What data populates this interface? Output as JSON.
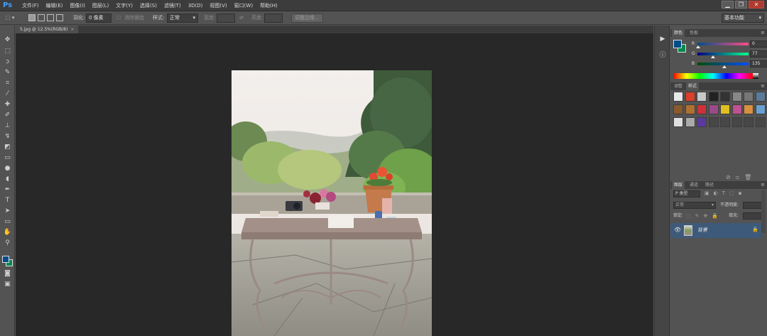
{
  "app": {
    "logo": "Ps"
  },
  "menu": [
    "文件(F)",
    "编辑(E)",
    "图像(I)",
    "图层(L)",
    "文字(Y)",
    "选择(S)",
    "滤镜(T)",
    "3D(D)",
    "视图(V)",
    "窗口(W)",
    "帮助(H)"
  ],
  "window_controls": {
    "minimize": "▁",
    "restore": "❐",
    "close": "✕"
  },
  "options_bar": {
    "feather_label": "羽化:",
    "feather_value": "0 像素",
    "antialias_label": "消除锯齿",
    "style_label": "样式:",
    "style_value": "正常",
    "width_label": "宽度:",
    "height_label": "高度:",
    "refine_edge_button": "调整边缘...",
    "workspace_value": "基本功能"
  },
  "document": {
    "tab_title": "5.jpg @ 12.5%(RGB/8)",
    "tab_close": "×"
  },
  "color_panel": {
    "tabs": [
      "颜色",
      "色板"
    ],
    "active_tab": "颜色",
    "channels": [
      {
        "label": "R",
        "value": "0"
      },
      {
        "label": "G",
        "value": "77"
      },
      {
        "label": "B",
        "value": "135"
      }
    ],
    "foreground_color": "#004d87",
    "background_color": "#00884d"
  },
  "styles_panel": {
    "tabs": [
      "调整",
      "样式"
    ],
    "active_tab": "样式"
  },
  "layers_panel": {
    "tabs": [
      "图层",
      "通道",
      "路径"
    ],
    "active_tab": "图层",
    "filter_value": "P 类型",
    "blend_mode": "正常",
    "opacity_label": "不透明度:",
    "lock_label": "锁定:",
    "fill_label": "填充:",
    "layers": [
      {
        "name": "背景",
        "visible": true,
        "locked": true
      }
    ]
  },
  "colors": {
    "menubar_bg": "#3c3c3c",
    "panel_bg": "#535353",
    "canvas_bg": "#282828",
    "selected_layer_bg": "#3d5a7a",
    "ps_blue": "#41a1ff"
  }
}
